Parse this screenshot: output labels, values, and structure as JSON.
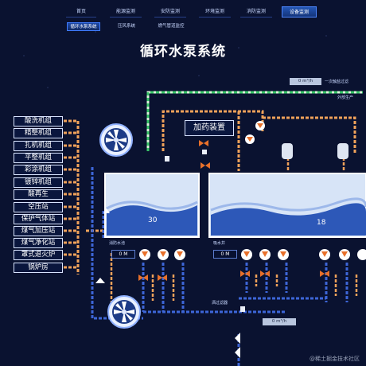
{
  "nav": {
    "tabs": [
      {
        "label": "首页",
        "active": false
      },
      {
        "label": "能源监测",
        "active": false
      },
      {
        "label": "安防监测",
        "active": false
      },
      {
        "label": "环境监测",
        "active": false
      },
      {
        "label": "消防监测",
        "active": false
      },
      {
        "label": "设备监测",
        "active": true
      }
    ]
  },
  "subnav": {
    "tabs": [
      {
        "label": "循环水泵系统",
        "active": true
      },
      {
        "label": "压风系统",
        "active": false
      },
      {
        "label": "燃气管道监控",
        "active": false
      }
    ]
  },
  "title": "循环水泵系统",
  "plants": [
    "酸洗机组",
    "精整机组",
    "扎机机组",
    "平整机组",
    "彩涂机组",
    "镀锌机组",
    "酸再生",
    "空压站",
    "保护气体站",
    "煤气加压站",
    "煤气净化站",
    "罩式退火炉",
    "锅炉房"
  ],
  "dosing_label": "加药装置",
  "flow_top": "0 m³/h",
  "flow_bottom": "0 m³/h",
  "label_primary_filter": "一次触盐过滤",
  "label_external": "外部生产",
  "tank_left": {
    "label": "消防水池",
    "level": "30",
    "meter": "0 M"
  },
  "tank_right": {
    "label": "吸水井",
    "level": "18",
    "meter": "0 M"
  },
  "label_filter": "洒过滤器",
  "watermark": "@稀土掘金技术社区",
  "colors": {
    "background": "#0a1230",
    "pipe_orange": "#f0a25a",
    "pipe_blue": "#2f58c8",
    "pipe_green": "#3ac86a",
    "water": "#2d58b8"
  }
}
